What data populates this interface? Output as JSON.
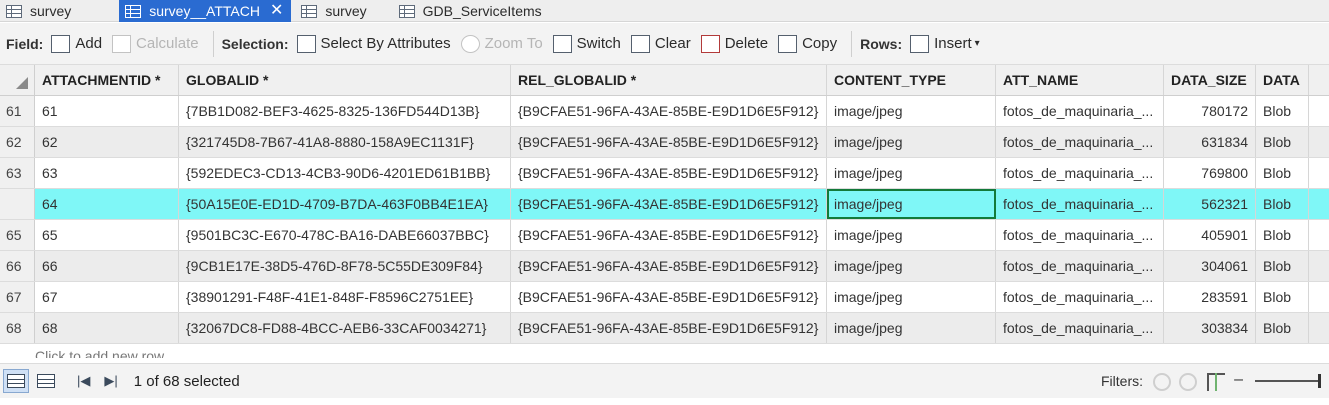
{
  "tabs": [
    {
      "label": "survey",
      "active": false
    },
    {
      "label": "survey__ATTACH",
      "active": true,
      "close": "✕"
    },
    {
      "label": "survey",
      "active": false
    },
    {
      "label": "GDB_ServiceItems",
      "active": false
    }
  ],
  "toolbar": {
    "field_label": "Field:",
    "add": "Add",
    "calculate": "Calculate",
    "selection_label": "Selection:",
    "select_by_attributes": "Select By Attributes",
    "zoom_to": "Zoom To",
    "switch": "Switch",
    "clear": "Clear",
    "delete": "Delete",
    "copy": "Copy",
    "rows_label": "Rows:",
    "insert": "Insert"
  },
  "table": {
    "columns": [
      "ATTACHMENTID *",
      "GLOBALID *",
      "REL_GLOBALID *",
      "CONTENT_TYPE",
      "ATT_NAME",
      "DATA_SIZE",
      "DATA"
    ],
    "rows": [
      {
        "num": "61",
        "id": "61",
        "globalid": "{7BB1D082-BEF3-4625-8325-136FD544D13B}",
        "rel": "{B9CFAE51-96FA-43AE-85BE-E9D1D6E5F912}",
        "type": "image/jpeg",
        "name": "fotos_de_maquinaria_...",
        "size": "780172",
        "data": "Blob"
      },
      {
        "num": "62",
        "id": "62",
        "globalid": "{321745D8-7B67-41A8-8880-158A9EC1131F}",
        "rel": "{B9CFAE51-96FA-43AE-85BE-E9D1D6E5F912}",
        "type": "image/jpeg",
        "name": "fotos_de_maquinaria_...",
        "size": "631834",
        "data": "Blob"
      },
      {
        "num": "63",
        "id": "63",
        "globalid": "{592EDEC3-CD13-4CB3-90D6-4201ED61B1BB}",
        "rel": "{B9CFAE51-96FA-43AE-85BE-E9D1D6E5F912}",
        "type": "image/jpeg",
        "name": "fotos_de_maquinaria_...",
        "size": "769800",
        "data": "Blob"
      },
      {
        "num": "",
        "id": "64",
        "globalid": "{50A15E0E-ED1D-4709-B7DA-463F0BB4E1EA}",
        "rel": "{B9CFAE51-96FA-43AE-85BE-E9D1D6E5F912}",
        "type": "image/jpeg",
        "name": "fotos_de_maquinaria_...",
        "size": "562321",
        "data": "Blob"
      },
      {
        "num": "65",
        "id": "65",
        "globalid": "{9501BC3C-E670-478C-BA16-DABE66037BBC}",
        "rel": "{B9CFAE51-96FA-43AE-85BE-E9D1D6E5F912}",
        "type": "image/jpeg",
        "name": "fotos_de_maquinaria_...",
        "size": "405901",
        "data": "Blob"
      },
      {
        "num": "66",
        "id": "66",
        "globalid": "{9CB1E17E-38D5-476D-8F78-5C55DE309F84}",
        "rel": "{B9CFAE51-96FA-43AE-85BE-E9D1D6E5F912}",
        "type": "image/jpeg",
        "name": "fotos_de_maquinaria_...",
        "size": "304061",
        "data": "Blob"
      },
      {
        "num": "67",
        "id": "67",
        "globalid": "{38901291-F48F-41E1-848F-F8596C2751EE}",
        "rel": "{B9CFAE51-96FA-43AE-85BE-E9D1D6E5F912}",
        "type": "image/jpeg",
        "name": "fotos_de_maquinaria_...",
        "size": "283591",
        "data": "Blob"
      },
      {
        "num": "68",
        "id": "68",
        "globalid": "{32067DC8-FD88-4BCC-AEB6-33CAF0034271}",
        "rel": "{B9CFAE51-96FA-43AE-85BE-E9D1D6E5F912}",
        "type": "image/jpeg",
        "name": "fotos_de_maquinaria_...",
        "size": "303834",
        "data": "Blob"
      }
    ],
    "add_row": "Click to add new row."
  },
  "status": {
    "selected": "1 of 68 selected",
    "filters_label": "Filters:"
  },
  "colors": {
    "accent": "#2a6bd1",
    "selected_row": "#7ff7f7",
    "focus_border": "#137a3a"
  }
}
